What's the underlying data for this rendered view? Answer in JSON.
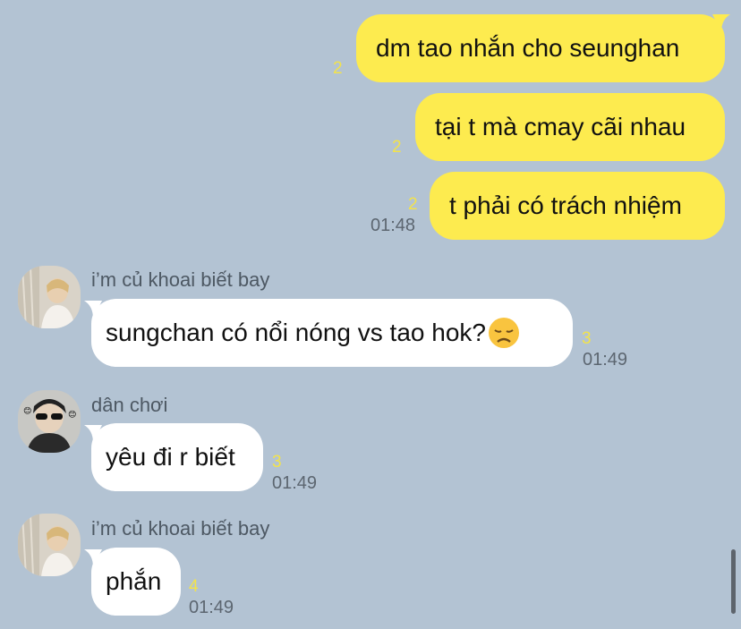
{
  "colors": {
    "background": "#b3c3d3",
    "outgoing_bubble": "#fdeb4f",
    "incoming_bubble": "#ffffff",
    "read_count": "#f3e34a",
    "timestamp": "#5c6670"
  },
  "outgoing": [
    {
      "text": "dm tao nhắn cho seunghan",
      "read": "2",
      "time": ""
    },
    {
      "text": "tại t mà cmay cãi nhau",
      "read": "2",
      "time": ""
    },
    {
      "text": "t phải có trách nhiệm",
      "read": "2",
      "time": "01:48"
    }
  ],
  "incoming": [
    {
      "sender": "i’m củ khoai biết bay",
      "text": "sungchan có nổi nóng vs tao hok?",
      "emoji": "disappointed-face-emoji",
      "read": "3",
      "time": "01:49",
      "avatar": "avatar-khoai"
    },
    {
      "sender": "dân chơi",
      "text": "yêu đi r biết",
      "read": "3",
      "time": "01:49",
      "avatar": "avatar-danchoi"
    },
    {
      "sender": "i’m củ khoai biết bay",
      "text": "phắn",
      "read": "4",
      "time": "01:49",
      "avatar": "avatar-khoai"
    }
  ]
}
